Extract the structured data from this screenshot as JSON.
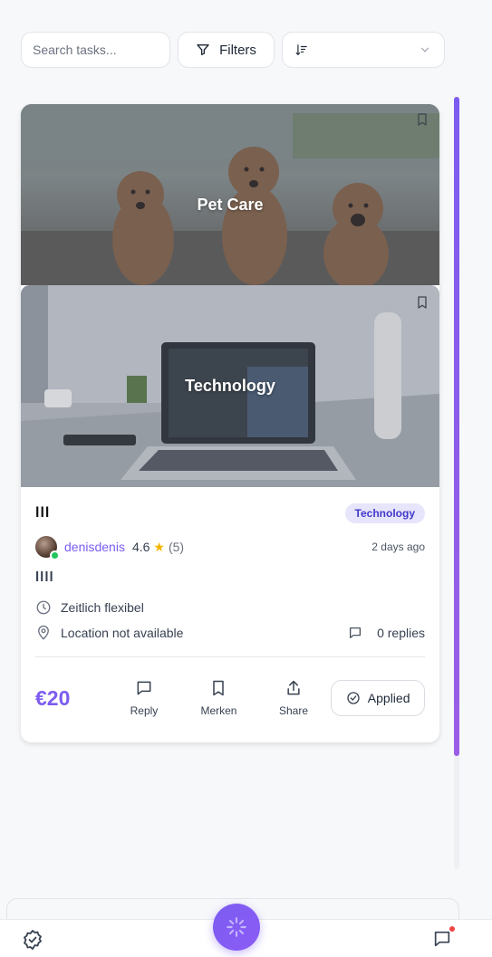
{
  "search": {
    "placeholder": "Search tasks..."
  },
  "toolbar": {
    "filters_label": "Filters",
    "sort_value": ""
  },
  "banners": [
    {
      "caption": "Pet Care"
    },
    {
      "caption": "Technology"
    }
  ],
  "task": {
    "title": "lll",
    "category_tag": "Technology",
    "author": {
      "username": "denisdenis",
      "rating": "4.6",
      "review_count": "(5)",
      "online": true
    },
    "posted": "2 days ago",
    "description": "llll",
    "schedule": "Zeitlich flexibel",
    "location": "Location not available",
    "replies": "0 replies",
    "price": "€20",
    "actions": {
      "reply": "Reply",
      "save": "Merken",
      "share": "Share",
      "applied": "Applied"
    }
  },
  "colors": {
    "accent": "#7c5cf0",
    "tag_bg": "#e6e5fb",
    "tag_text": "#4338ca",
    "online": "#22c55e",
    "notification": "#ef4444"
  },
  "icons": [
    "filter-icon",
    "sort-icon",
    "chevron-down-icon",
    "bookmark-icon",
    "clock-icon",
    "location-pin-icon",
    "chat-bubble-icon",
    "share-icon",
    "check-circle-icon",
    "spinner-icon",
    "messages-icon"
  ]
}
